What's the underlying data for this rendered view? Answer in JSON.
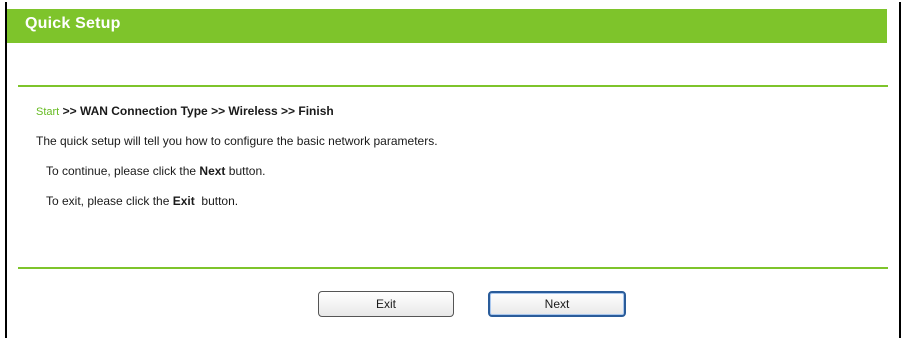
{
  "header": {
    "title": "Quick Setup"
  },
  "breadcrumb": {
    "current": "Start",
    "separator": ">>",
    "steps": [
      "WAN Connection Type",
      "Wireless",
      "Finish"
    ]
  },
  "body": {
    "intro": "The quick setup will tell you how to configure the basic network parameters.",
    "continue_prefix": "To continue, please click the ",
    "continue_bold": "Next",
    "continue_suffix": " button.",
    "exit_prefix": "To exit, please click the ",
    "exit_bold": "Exit",
    "exit_suffix": "  button."
  },
  "buttons": {
    "exit_label": "Exit",
    "next_label": "Next"
  },
  "colors": {
    "header_green": "#7ec42b",
    "breadcrumb_current": "#66bb22",
    "next_focus_border": "#2a5c9a"
  }
}
